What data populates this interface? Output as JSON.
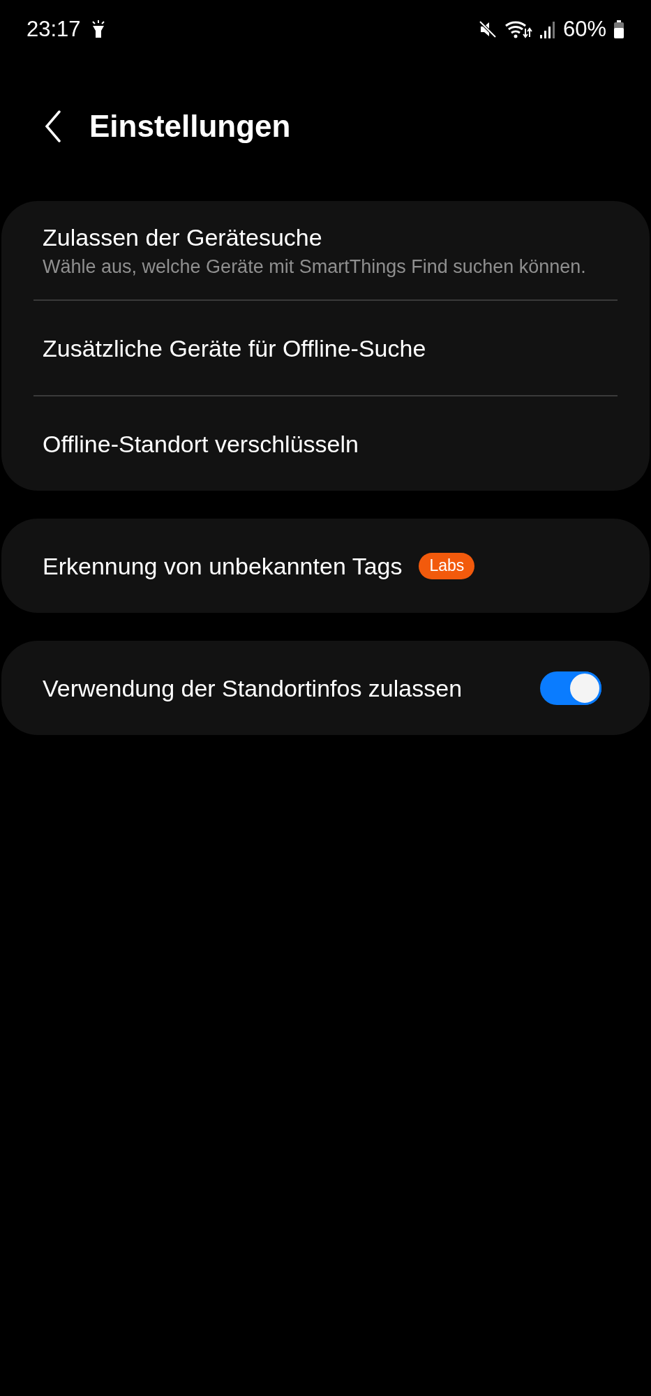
{
  "status_bar": {
    "time": "23:17",
    "battery": "60%"
  },
  "header": {
    "title": "Einstellungen"
  },
  "groups": [
    {
      "items": [
        {
          "kind": "link",
          "title": "Zulassen der Gerätesuche",
          "subtitle": "Wähle aus, welche Geräte mit SmartThings Find suchen können."
        },
        {
          "kind": "link",
          "title": "Zusätzliche Geräte für Offline-Suche"
        },
        {
          "kind": "link",
          "title": "Offline-Standort verschlüsseln"
        }
      ]
    },
    {
      "items": [
        {
          "kind": "badge",
          "title": "Erkennung von unbekannten Tags",
          "badge": "Labs",
          "color": "#f25a0c"
        }
      ]
    },
    {
      "items": [
        {
          "kind": "switch",
          "title": "Verwendung der Standortinfos zulassen",
          "on": true
        }
      ]
    }
  ]
}
